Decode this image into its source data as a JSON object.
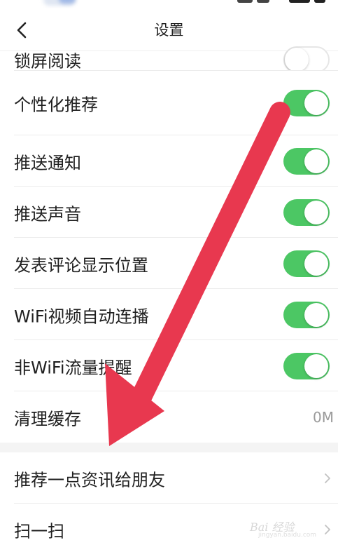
{
  "header": {
    "title": "设置",
    "back_icon": "chevron-left-icon"
  },
  "settings": {
    "lock_screen_reading": {
      "label": "锁屏阅读",
      "enabled": false
    },
    "personalized_recommendation": {
      "label": "个性化推荐",
      "enabled": true
    },
    "push_notification": {
      "label": "推送通知",
      "enabled": true
    },
    "push_sound": {
      "label": "推送声音",
      "enabled": true
    },
    "comment_location": {
      "label": "发表评论显示位置",
      "enabled": true
    },
    "wifi_autoplay": {
      "label": "WiFi视频自动连播",
      "enabled": true
    },
    "non_wifi_reminder": {
      "label": "非WiFi流量提醒",
      "enabled": true
    },
    "clear_cache": {
      "label": "清理缓存",
      "value": "0M"
    }
  },
  "links": {
    "recommend_to_friends": {
      "label": "推荐一点资讯给朋友",
      "icon": "chevron-right-icon"
    },
    "scan": {
      "label": "扫一扫",
      "icon": "chevron-right-icon"
    }
  },
  "annotation": {
    "type": "red-arrow",
    "color": "#e8384f"
  },
  "colors": {
    "toggle_on": "#4cc764",
    "toggle_off_border": "#e6e6e6",
    "section_gap": "#f4f4f4",
    "value_text": "#9a9a9a"
  },
  "watermark": {
    "text": "Bai 经验",
    "sub": "jingyan.baidu.com"
  }
}
